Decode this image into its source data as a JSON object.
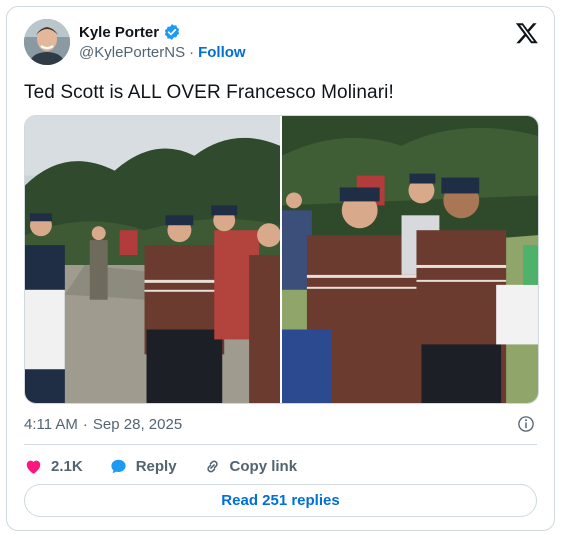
{
  "author": {
    "name": "Kyle Porter",
    "handle": "@KylePorterNS",
    "separator": "·",
    "follow_label": "Follow",
    "verified_color": "#1d9bf0",
    "icons": [
      "avatar",
      "verified-badge-icon",
      "x-logo-icon"
    ]
  },
  "tweet": {
    "text": "Ted Scott is ALL OVER Francesco Molinari!",
    "media": [
      {
        "label": "photo-left"
      },
      {
        "label": "photo-right"
      }
    ]
  },
  "meta": {
    "time": "4:11 AM",
    "separator": "·",
    "date": "Sep 28, 2025",
    "info_icon": "info-icon"
  },
  "actions": {
    "like_count": "2.1K",
    "reply_label": "Reply",
    "copy_label": "Copy link",
    "icons": [
      "heart-icon",
      "reply-bubble-icon",
      "link-icon"
    ],
    "colors": {
      "heart": "#f91880",
      "reply": "#1d9bf0"
    }
  },
  "footer": {
    "read_replies": "Read 251 replies"
  },
  "colors": {
    "accent": "#006fd6",
    "muted_text": "#536471",
    "border": "#cfd9de"
  }
}
